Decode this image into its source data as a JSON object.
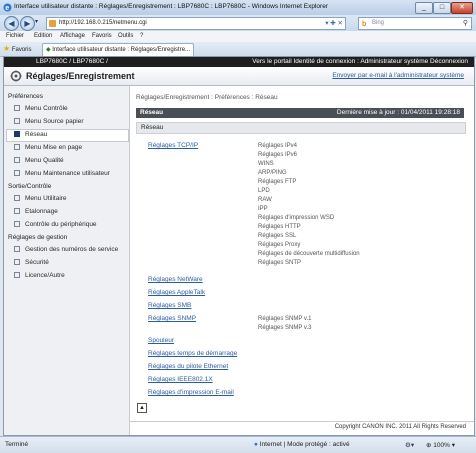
{
  "window": {
    "title": "Interface utilisateur distante : Réglages/Enregistrement : LBP7680C : LBP7680C - Windows Internet Explorer",
    "buttons": [
      "_",
      "□",
      "✕"
    ]
  },
  "address": {
    "url": "http://192.168.0.215/netmenu.cgi",
    "tools": "▾ ✚ ✕",
    "search_placeholder": "Bing",
    "search_engine_icon": "b"
  },
  "menu": [
    "Fichier",
    "Edition",
    "Affichage",
    "Favoris",
    "Outils",
    "?"
  ],
  "favorites": {
    "label": "Favoris",
    "tab_label": "Interface utilisateur distante : Réglages/Enregistre..."
  },
  "page": {
    "product": "LBP7680C / LBP7680C /",
    "top_links": "Vers le portail   Identité de connexion : Administrateur système  Déconnexion",
    "title": "Réglages/Enregistrement",
    "email_link": "Envoyer par e-mail à l'administrateur système"
  },
  "sidebar": {
    "groups": [
      {
        "heading": "Préférences",
        "items": [
          "Menu Contrôle",
          "Menu Source papier",
          "Réseau",
          "Menu Mise en page",
          "Menu Qualité",
          "Menu Maintenance utilisateur"
        ]
      },
      {
        "heading": "Sortie/Contrôle",
        "items": [
          "Menu Utilitaire",
          "Etalonnage",
          "Contrôle du périphérique"
        ]
      },
      {
        "heading": "Réglages de gestion",
        "items": [
          "Gestion des numéros de service",
          "Sécurité",
          "Licence/Autre"
        ]
      }
    ],
    "active": "Réseau"
  },
  "content": {
    "breadcrumb": "Réglages/Enregistrement : Préférences : Réseau",
    "section_title": "Réseau",
    "last_update": "Dernière mise à jour : 01/04/2011 19:28:18",
    "sub_title": "Réseau",
    "tcp_link": "Réglages TCP/IP",
    "tcp_items": [
      "Réglages IPv4",
      "Réglages IPv6",
      "WINS",
      "ARP/PING",
      "Réglages FTP",
      "LPD",
      "RAW",
      "IPP",
      "Réglages d'impression WSD",
      "Réglages HTTP",
      "Réglages SSL",
      "Réglages Proxy",
      "Réglages de découverte multidiffusion",
      "Réglages SNTP"
    ],
    "links_a": [
      "Réglages NetWare",
      "Réglages AppleTalk",
      "Réglages SMB"
    ],
    "snmp_link": "Réglages SNMP",
    "snmp_items": [
      "Réglages SNMP v.1",
      "Réglages SNMP v.3"
    ],
    "links_b": [
      "Spouleur",
      "Réglages temps de démarrage",
      "Réglages du pilote Ethernet",
      "Réglages IEEE802.1X",
      "Réglages d'impression E-mail"
    ],
    "top_button": "▲",
    "copyright": "Copyright CANON INC. 2011 All Rights Reserved"
  },
  "status": {
    "left": "Terminé",
    "zone": "Internet | Mode protégé : activé",
    "zoom": "100%"
  }
}
